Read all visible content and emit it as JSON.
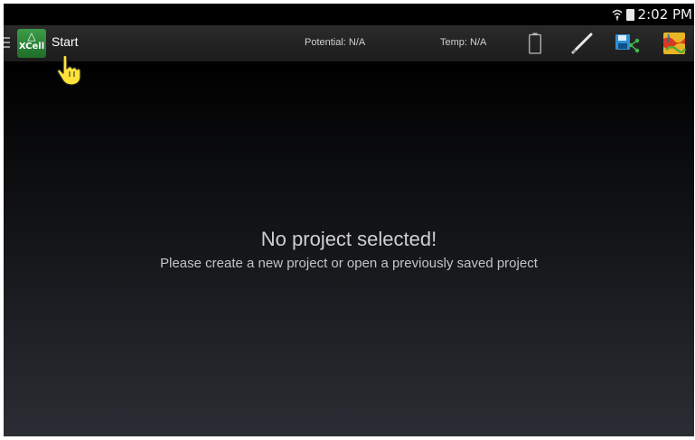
{
  "status_bar": {
    "time": "2:02 PM",
    "icons": [
      "wifi-icon",
      "battery-icon"
    ]
  },
  "app_bar": {
    "logo_text": "XCell",
    "title": "Start",
    "potential": "Potential: N/A",
    "temp": "Temp: N/A",
    "actions": [
      "battery-icon",
      "pen-icon",
      "save-share-icon",
      "map-icon"
    ]
  },
  "empty_state": {
    "title": "No project selected!",
    "subtitle": "Please create a new project or open a previously saved project"
  },
  "colors": {
    "logo_green": "#2e8b3c",
    "save_icon_blue": "#2f8fd6",
    "share_green": "#3cba4a",
    "cursor_yellow": "#ffe23a"
  }
}
